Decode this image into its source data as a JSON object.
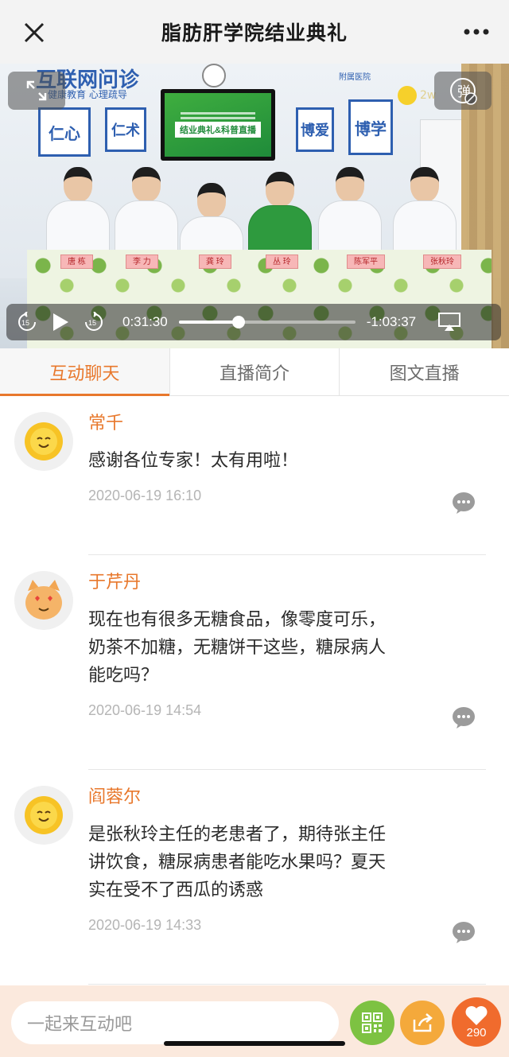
{
  "nav": {
    "title": "脂肪肝学院结业典礼",
    "close_icon": "close-icon",
    "more_icon": "more-dots-icon"
  },
  "video": {
    "scene": {
      "wall_banner": "互联网问诊",
      "wall_sub": "健康教育 心理疏导",
      "hospital": "附属医院",
      "signs": [
        "仁心",
        "仁术",
        "博爱",
        "博学"
      ],
      "tv_title": "结业典礼&科普直播",
      "nameplates": [
        "唐 栋",
        "李 力",
        "龚 玲",
        "丛 玲",
        "陈军平",
        "张秋玲"
      ]
    },
    "viewer_count": "2w",
    "danmaku_label": "弹",
    "current_time": "0:31:30",
    "remaining_time": "-1:03:37",
    "progress": 0.34,
    "rewind_label": "15",
    "forward_label": "15"
  },
  "tabs": [
    {
      "label": "互动聊天",
      "active": true
    },
    {
      "label": "直播简介",
      "active": false
    },
    {
      "label": "图文直播",
      "active": false
    }
  ],
  "comments": [
    {
      "author": "常千",
      "avatar": "sun-face-avatar",
      "lines": [
        "感谢各位专家！太有用啦！"
      ],
      "timestamp": "2020-06-19 16:10"
    },
    {
      "author": "于芹丹",
      "avatar": "cat-face-avatar",
      "lines": [
        "现在也有很多无糖食品，像零度可乐，",
        "奶茶不加糖，无糖饼干这些，糖尿病人",
        "能吃吗？"
      ],
      "timestamp": "2020-06-19 14:54"
    },
    {
      "author": "阎蓉尔",
      "avatar": "sun-face-avatar",
      "lines": [
        "是张秋玲主任的老患者了，期待张主任",
        "讲饮食，糖尿病患者能吃水果吗？夏天",
        "实在受不了西瓜的诱惑"
      ],
      "timestamp": "2020-06-19 14:33"
    }
  ],
  "bottom": {
    "input_placeholder": "一起来互动吧",
    "like_count": "290"
  },
  "colors": {
    "accent": "#e8782c",
    "qr_button": "#7dc242",
    "share_button": "#f4a93b",
    "like_button": "#f06b2d"
  }
}
